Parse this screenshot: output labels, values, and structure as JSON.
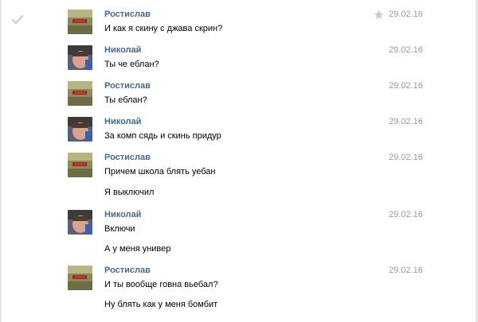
{
  "conversation": {
    "messages": [
      {
        "author": "Ростислав",
        "avatar": "avatar-rostislav",
        "date": "29.02.16",
        "lines": [
          "И как я скину с джава скрин?"
        ],
        "starred": true,
        "selected_check": true
      },
      {
        "author": "Николай",
        "avatar": "avatar-nikolai",
        "date": "29.02.16",
        "lines": [
          "Ты че еблан?"
        ]
      },
      {
        "author": "Ростислав",
        "avatar": "avatar-rostislav",
        "date": "29.02.16",
        "lines": [
          "Ты еблан?"
        ]
      },
      {
        "author": "Николай",
        "avatar": "avatar-nikolai",
        "date": "29.02.16",
        "lines": [
          "За комп сядь и скинь придур"
        ]
      },
      {
        "author": "Ростислав",
        "avatar": "avatar-rostislav",
        "date": "29.02.16",
        "lines": [
          "Причем школа блять уебан",
          "Я выключил"
        ]
      },
      {
        "author": "Николай",
        "avatar": "avatar-nikolai",
        "date": "29.02.16",
        "lines": [
          "Включи",
          "А у меня универ"
        ]
      },
      {
        "author": "Ростислав",
        "avatar": "avatar-rostislav",
        "date": "29.02.16",
        "lines": [
          "И ты вообще говна вьебал?",
          "Ну блять как у меня бомбит"
        ]
      }
    ]
  },
  "colors": {
    "name": "#45688e",
    "date": "#999999",
    "text": "#000000",
    "border": "#e3e6ea"
  }
}
